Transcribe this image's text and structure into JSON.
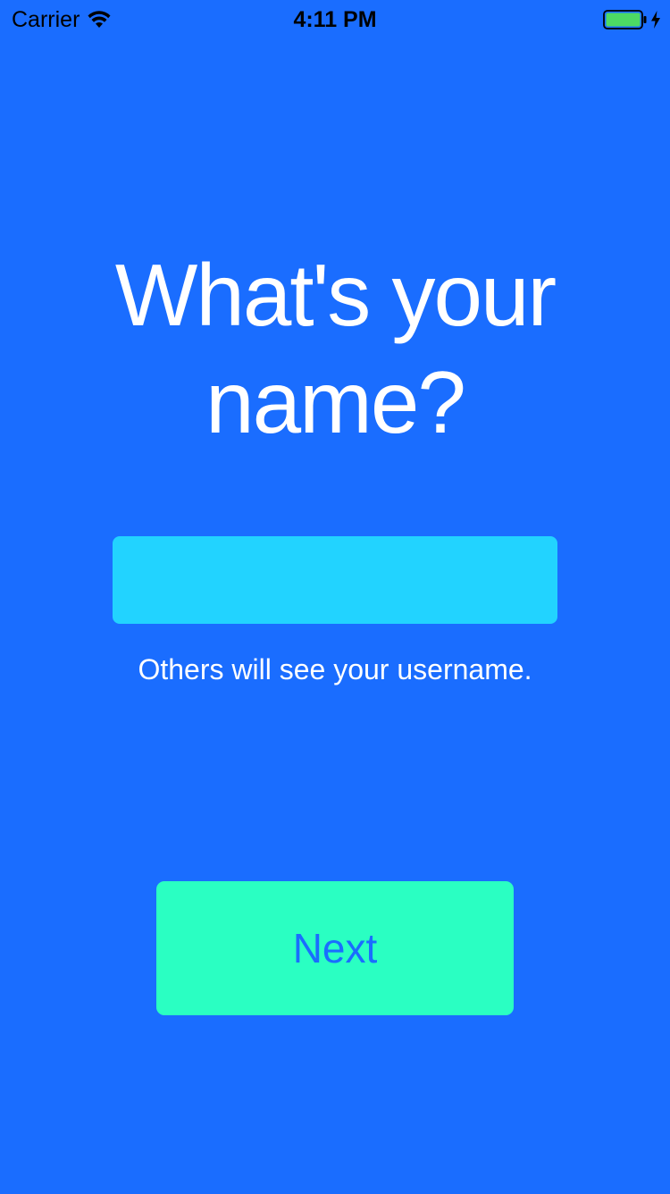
{
  "status_bar": {
    "carrier": "Carrier",
    "time": "4:11 PM",
    "wifi_icon": "wifi-icon",
    "battery_icon": "battery-icon",
    "charging_icon": "charging-bolt-icon",
    "battery_color": "#4cd964"
  },
  "main": {
    "heading": "What's your name?",
    "name_input": {
      "value": "",
      "placeholder": ""
    },
    "hint": "Others will see your username.",
    "next_label": "Next"
  },
  "colors": {
    "background": "#1a6dff",
    "input_background": "#22d3ff",
    "button_background": "#2affc2",
    "button_text": "#1a6dff",
    "text": "#ffffff"
  }
}
